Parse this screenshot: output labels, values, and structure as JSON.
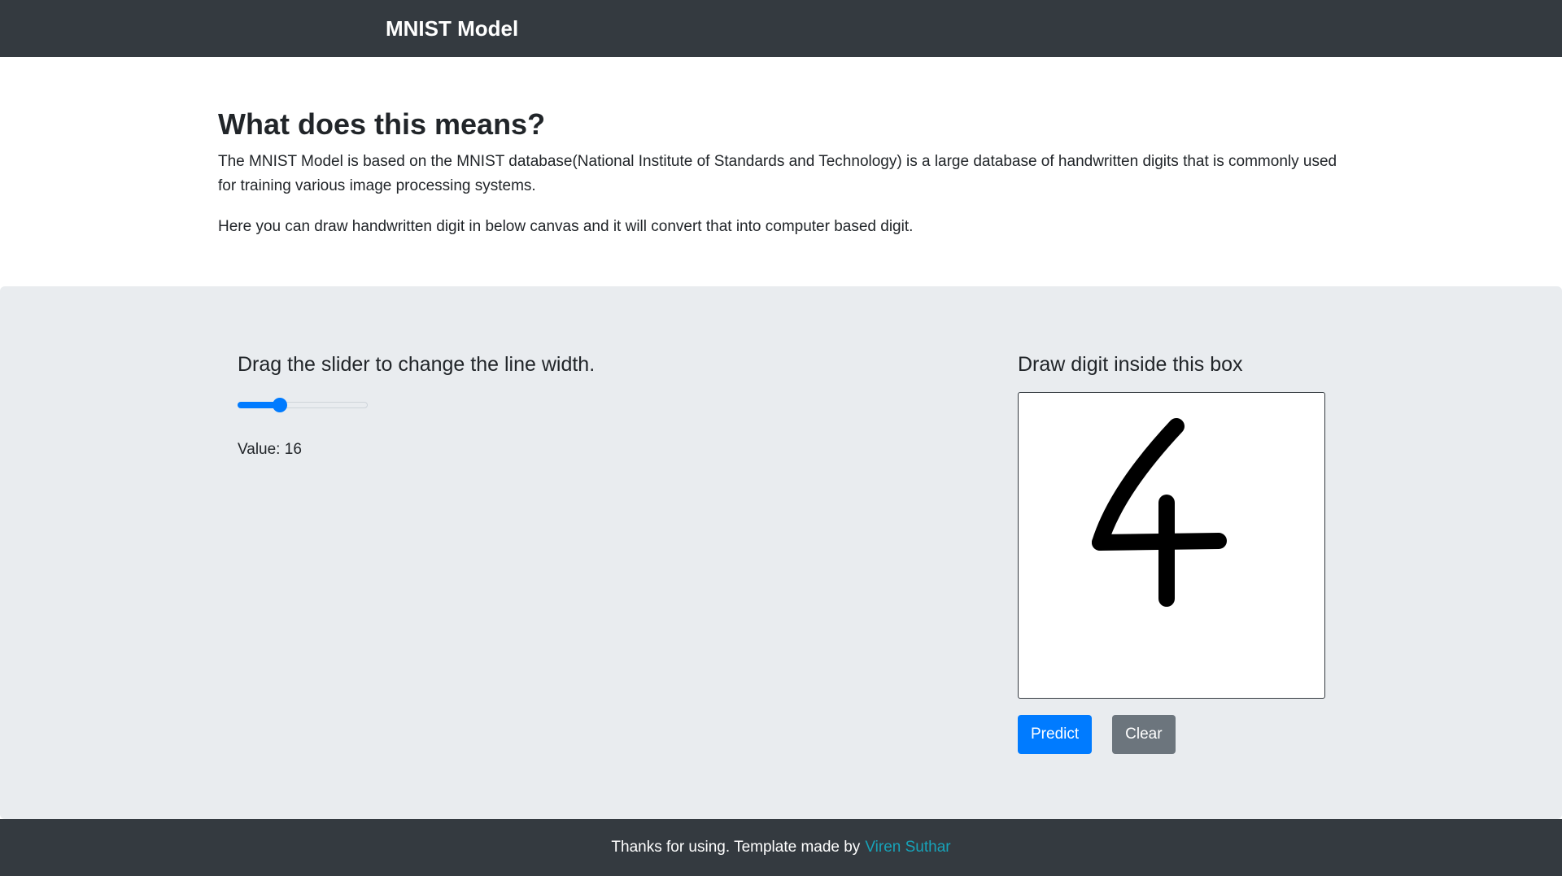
{
  "navbar": {
    "brand": "MNIST Model"
  },
  "intro": {
    "heading": "What does this means?",
    "paragraph1": "The MNIST Model is based on the MNIST database(National Institute of Standards and Technology) is a large database of handwritten digits that is commonly used for training various image processing systems.",
    "paragraph2": "Here you can draw handwritten digit in below canvas and it will convert that into computer based digit."
  },
  "slider": {
    "heading": "Drag the slider to change the line width.",
    "value_label": "Value:",
    "value": 16,
    "min": 1,
    "max": 50,
    "accent": "#007bff"
  },
  "canvas": {
    "heading": "Draw digit inside this box",
    "drawn_digit": "4",
    "stroke_color": "#000000"
  },
  "buttons": {
    "predict_label": "Predict",
    "clear_label": "Clear",
    "predict_color": "#007bff",
    "clear_color": "#6c757d"
  },
  "footer": {
    "text": "Thanks for using. Template made by",
    "link_text": "Viren Suthar",
    "link_color": "#17a2b8"
  }
}
